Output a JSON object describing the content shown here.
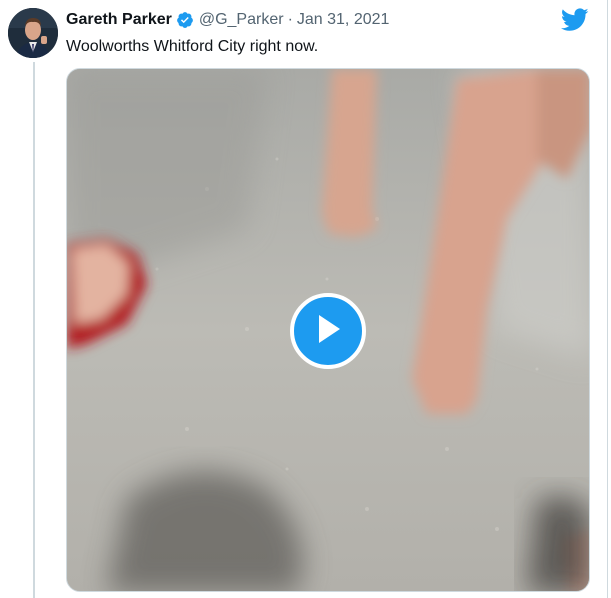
{
  "tweet": {
    "author_name": "Gareth Parker",
    "handle": "@G_Parker",
    "separator": "·",
    "date": "Jan 31, 2021",
    "text": "Woolworths Whitford City right now."
  },
  "icons": {
    "verified": "verified-badge-icon",
    "platform": "twitter-bird-icon",
    "play": "play-icon"
  },
  "colors": {
    "accent": "#1d9bf0",
    "text": "#0f1419",
    "secondary_text": "#536471"
  }
}
